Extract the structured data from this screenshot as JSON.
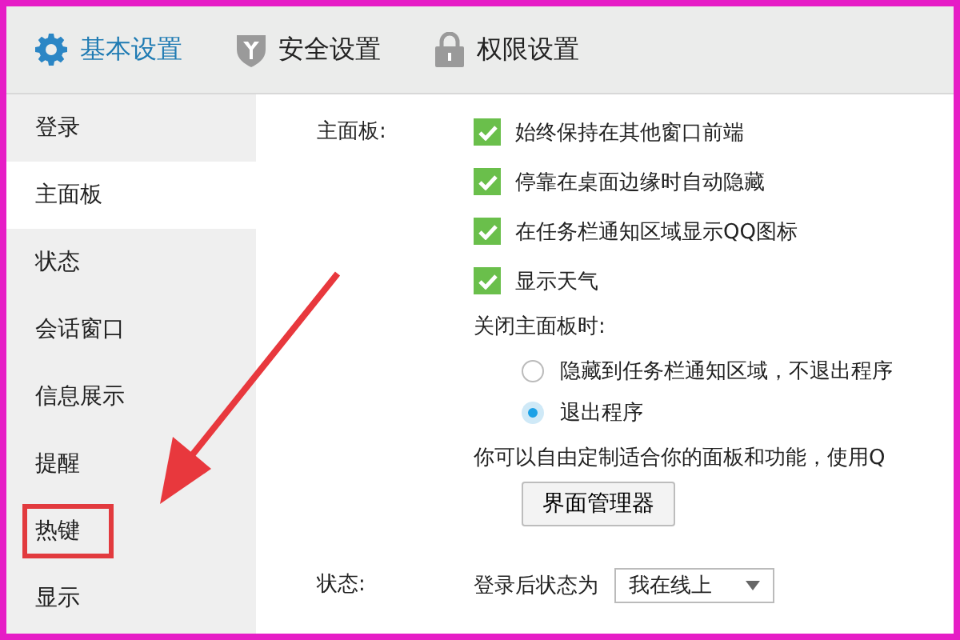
{
  "tabs": [
    {
      "label": "基本设置",
      "kind": "gear",
      "selected": true
    },
    {
      "label": "安全设置",
      "kind": "shield",
      "selected": false
    },
    {
      "label": "权限设置",
      "kind": "lock",
      "selected": false
    }
  ],
  "sidebar": {
    "items": [
      {
        "label": "登录",
        "selected": false,
        "highlighted": false
      },
      {
        "label": "主面板",
        "selected": true,
        "highlighted": false
      },
      {
        "label": "状态",
        "selected": false,
        "highlighted": false
      },
      {
        "label": "会话窗口",
        "selected": false,
        "highlighted": false
      },
      {
        "label": "信息展示",
        "selected": false,
        "highlighted": false
      },
      {
        "label": "提醒",
        "selected": false,
        "highlighted": false
      },
      {
        "label": "热键",
        "selected": false,
        "highlighted": true
      },
      {
        "label": "显示",
        "selected": false,
        "highlighted": false
      }
    ]
  },
  "main_panel": {
    "label": "主面板:",
    "options": [
      {
        "label": "始终保持在其他窗口前端",
        "checked": true
      },
      {
        "label": "停靠在桌面边缘时自动隐藏",
        "checked": true
      },
      {
        "label": "在任务栏通知区域显示QQ图标",
        "checked": true
      },
      {
        "label": "显示天气",
        "checked": true
      }
    ],
    "close_label": "关闭主面板时:",
    "close_options": [
      {
        "label": "隐藏到任务栏通知区域，不退出程序",
        "selected": false
      },
      {
        "label": "退出程序",
        "selected": true
      }
    ],
    "note": "你可以自由定制适合你的面板和功能，使用Q",
    "button": "界面管理器"
  },
  "status": {
    "label": "状态:",
    "field_label": "登录后状态为",
    "value": "我在线上"
  },
  "annotation": {
    "kind": "arrow"
  }
}
